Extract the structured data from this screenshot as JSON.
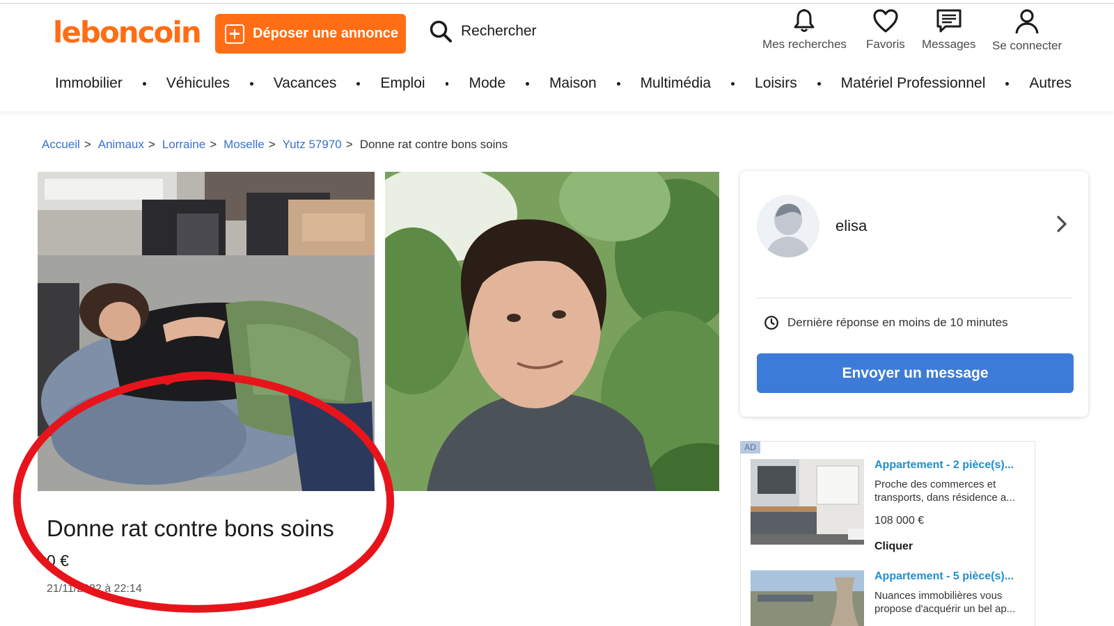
{
  "header": {
    "logo": "leboncoin",
    "post_button": "Déposer une annonce",
    "search_label": "Rechercher",
    "nav_icons": [
      {
        "label": "Mes recherches",
        "icon": "bell-icon"
      },
      {
        "label": "Favoris",
        "icon": "heart-icon"
      },
      {
        "label": "Messages",
        "icon": "message-icon"
      },
      {
        "label": "Se connecter",
        "icon": "user-icon"
      }
    ],
    "categories": [
      "Immobilier",
      "Véhicules",
      "Vacances",
      "Emploi",
      "Mode",
      "Maison",
      "Multimédia",
      "Loisirs",
      "Matériel Professionnel",
      "Autres"
    ]
  },
  "breadcrumb": {
    "links": [
      "Accueil",
      "Animaux",
      "Lorraine",
      "Moselle",
      "Yutz 57970"
    ],
    "separator": ">",
    "current": "Donne rat contre bons soins"
  },
  "listing": {
    "title": "Donne rat contre bons soins",
    "price": "0 €",
    "date": "21/11/2022 à 22:14"
  },
  "seller": {
    "name": "elisa",
    "response_time": "Dernière réponse en moins de 10 minutes",
    "message_button": "Envoyer un message"
  },
  "ads": {
    "tag": "AD",
    "items": [
      {
        "title": "Appartement - 2 pièce(s)...",
        "description": "Proche des commerces et transports, dans résidence a...",
        "price": "108 000 €",
        "cta": "Cliquer"
      },
      {
        "title": "Appartement - 5 pièce(s)...",
        "description": "Nuances immobilières vous propose d'acquérir un bel ap...",
        "price": "",
        "cta": ""
      }
    ]
  },
  "colors": {
    "brand_orange": "#ff6e14",
    "link_blue": "#3a6fcf",
    "button_blue": "#3d7bd9",
    "ad_title_blue": "#1f8fd0",
    "annotation_red": "#e8141b"
  }
}
